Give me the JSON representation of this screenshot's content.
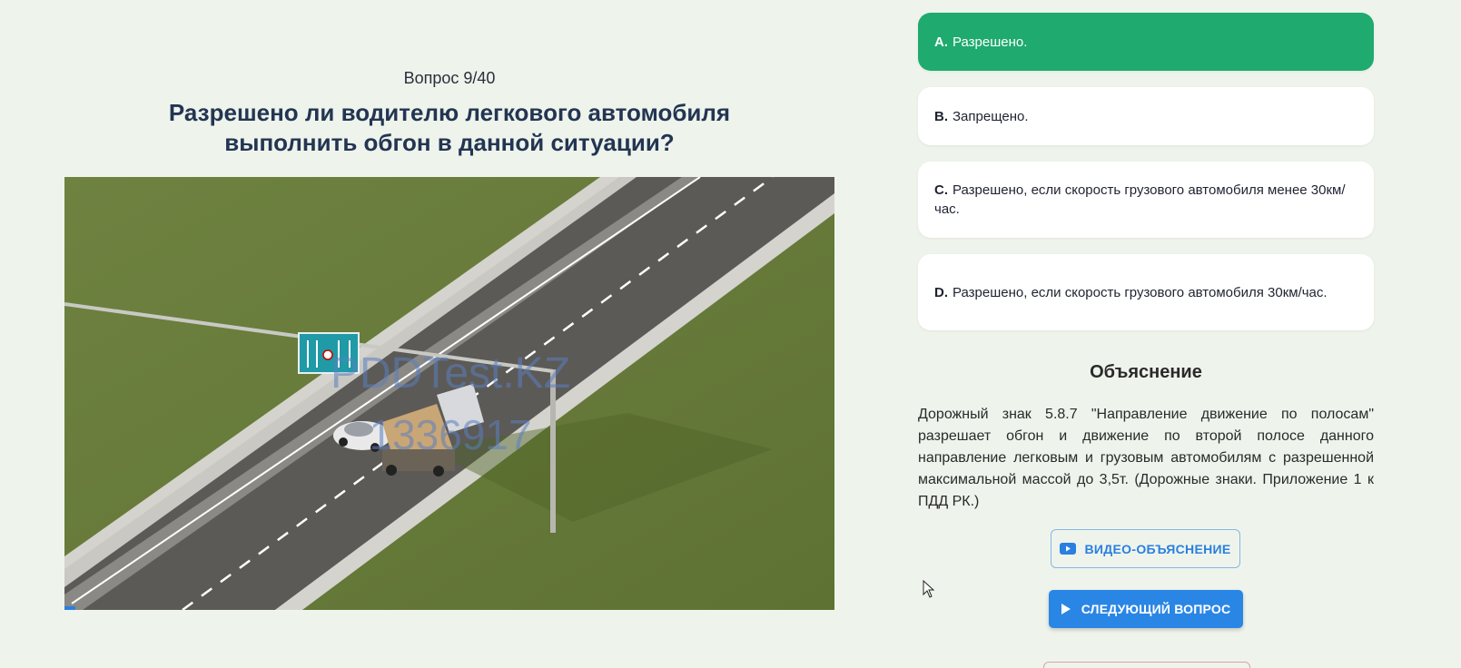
{
  "question": {
    "counter": "Вопрос 9/40",
    "text": "Разрешено ли водителю легкового автомобиля выполнить обгон в данной ситуации?",
    "watermark_line1": "PDDTest.KZ",
    "watermark_line2": "1336917"
  },
  "options": [
    {
      "letter": "A.",
      "text": "Разрешено.",
      "selected": true
    },
    {
      "letter": "B.",
      "text": "Запрещено.",
      "selected": false
    },
    {
      "letter": "C.",
      "text": "Разрешено, если скорость грузового автомобиля менее 30км/час.",
      "selected": false
    },
    {
      "letter": "D.",
      "text": "Разрешено, если скорость грузового автомобиля 30км/час.",
      "selected": false
    }
  ],
  "explanation": {
    "title": "Объяснение",
    "text": "Дорожный знак 5.8.7 \"Направление движение по полосам\" разрешает обгон и движение по второй полосе данного направление легковым и грузовым автомобилям с разрешенной максимальной массой до 3,5т. (Дорожные знаки. Приложение 1 к ПДД РК.)"
  },
  "buttons": {
    "video_label": "ВИДЕО-ОБЪЯСНЕНИЕ",
    "next_label": "СЛЕДУЮЩИЙ ВОПРОС"
  },
  "colors": {
    "background": "#eef4ec",
    "selected_option": "#1faa6f",
    "primary_button": "#2a86e5",
    "question_text": "#233552"
  }
}
